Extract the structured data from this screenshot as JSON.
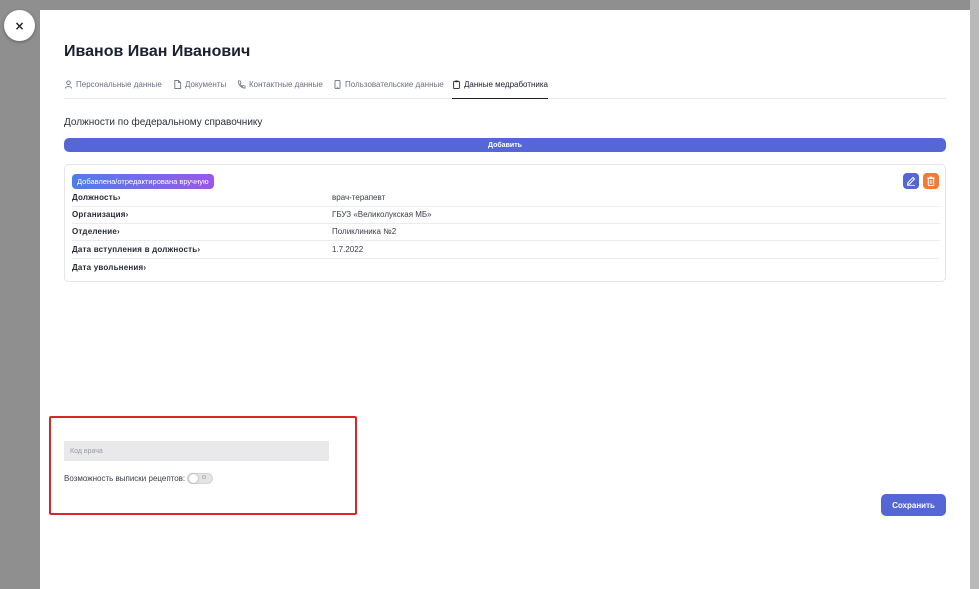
{
  "close": {
    "symbol": "×"
  },
  "title": "Иванов Иван Иванович",
  "tabs": [
    {
      "label": "Персональные данные",
      "icon": "user-icon",
      "active": false
    },
    {
      "label": "Документы",
      "icon": "document-icon",
      "active": false
    },
    {
      "label": "Контактные данные",
      "icon": "phone-icon",
      "active": false
    },
    {
      "label": "Пользовательские данные",
      "icon": "mobile-icon",
      "active": false
    },
    {
      "label": "Данные медработника",
      "icon": "clipboard-icon",
      "active": true
    }
  ],
  "section": {
    "title": "Должности по федеральному справочнику",
    "add_label": "Добавить"
  },
  "record": {
    "badge": "Добавлена/отредактирована вручную",
    "actions": {
      "edit_icon": "pencil-icon",
      "delete_icon": "trash-icon"
    },
    "fields": [
      {
        "label": "Должность",
        "value": "врач-терапевт"
      },
      {
        "label": "Организация",
        "value": "ГБУЗ «Великолукская МБ»"
      },
      {
        "label": "Отделение",
        "value": "Поликлиника №2"
      },
      {
        "label": "Дата вступления в должность",
        "value": "1.7.2022"
      },
      {
        "label": "Дата увольнения",
        "value": ""
      }
    ]
  },
  "doctor_code": {
    "placeholder": "Код врача",
    "value": ""
  },
  "prescription": {
    "label": "Возможность выписки рецептов:",
    "enabled": false,
    "state_text": "О"
  },
  "save_label": "Сохранить",
  "colors": {
    "accent": "#5566d6",
    "danger": "#f07a3a",
    "highlight": "#d9262c",
    "badge_from": "#4f7ee8",
    "badge_to": "#9b57e8"
  }
}
